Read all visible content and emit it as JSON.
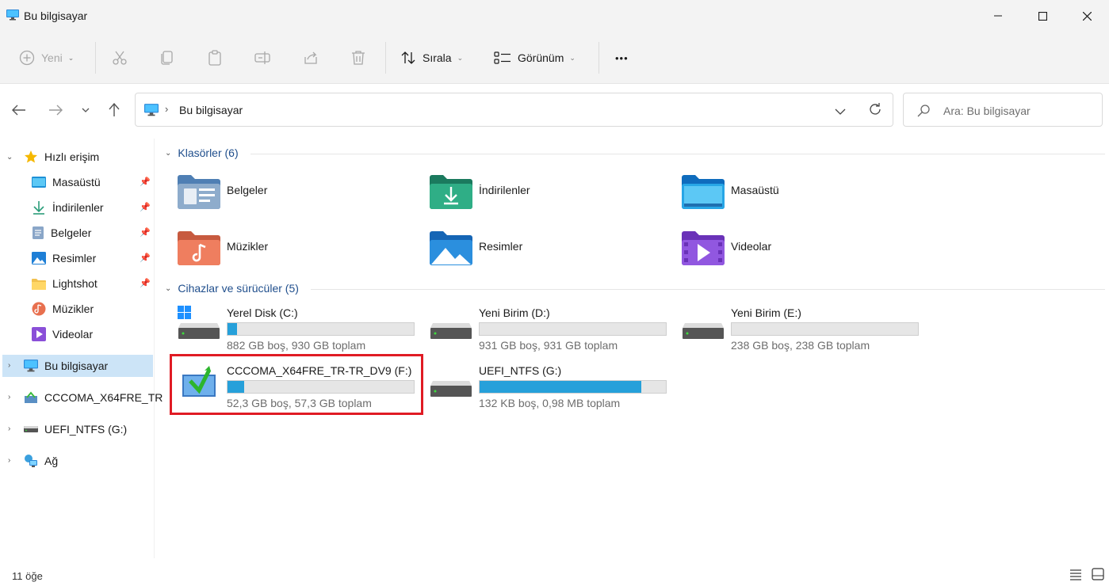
{
  "window": {
    "title": "Bu bilgisayar"
  },
  "toolbar": {
    "new_label": "Yeni",
    "sort_label": "Sırala",
    "view_label": "Görünüm",
    "more_label": "•••"
  },
  "address": {
    "location": "Bu bilgisayar",
    "search_placeholder": "Ara: Bu bilgisayar"
  },
  "sidebar": {
    "quick_access": "Hızlı erişim",
    "quick_items": [
      {
        "label": "Masaüstü",
        "icon": "desktop-icon"
      },
      {
        "label": "İndirilenler",
        "icon": "download-icon"
      },
      {
        "label": "Belgeler",
        "icon": "documents-icon"
      },
      {
        "label": "Resimler",
        "icon": "pictures-icon"
      },
      {
        "label": "Lightshot",
        "icon": "folder-icon"
      },
      {
        "label": "Müzikler",
        "icon": "music-icon"
      },
      {
        "label": "Videolar",
        "icon": "videos-icon"
      }
    ],
    "this_pc": "Bu bilgisayar",
    "usb_drive": "CCCOMA_X64FRE_TR",
    "uefi": "UEFI_NTFS (G:)",
    "network": "Ağ"
  },
  "folders_section": {
    "title": "Klasörler (6)"
  },
  "folders": [
    {
      "name": "Belgeler",
      "color": "#5b8fc7"
    },
    {
      "name": "İndirilenler",
      "color": "#2a9d7a"
    },
    {
      "name": "Masaüstü",
      "color": "#1ea0e0"
    },
    {
      "name": "Müzikler",
      "color": "#e8704f"
    },
    {
      "name": "Resimler",
      "color": "#2b8fde"
    },
    {
      "name": "Videolar",
      "color": "#8a4fd8"
    }
  ],
  "drives_section": {
    "title": "Cihazlar ve sürücüler (5)"
  },
  "drives": [
    {
      "name": "Yerel Disk (C:)",
      "info": "882 GB boş, 930 GB toplam",
      "used_fraction": 0.05
    },
    {
      "name": "Yeni Birim (D:)",
      "info": "931 GB boş, 931 GB toplam",
      "used_fraction": 0.0
    },
    {
      "name": "Yeni Birim (E:)",
      "info": "238 GB boş, 238 GB toplam",
      "used_fraction": 0.0
    },
    {
      "name": "CCCOMA_X64FRE_TR-TR_DV9 (F:)",
      "info": "52,3 GB boş, 57,3 GB toplam",
      "used_fraction": 0.09
    },
    {
      "name": "UEFI_NTFS (G:)",
      "info": "132 KB boş, 0,98 MB toplam",
      "used_fraction": 0.87
    }
  ],
  "status": {
    "count": "11 öğe"
  },
  "colors": {
    "accent": "#26a0da",
    "selection": "#cce4f7",
    "highlight": "#e01b24"
  }
}
